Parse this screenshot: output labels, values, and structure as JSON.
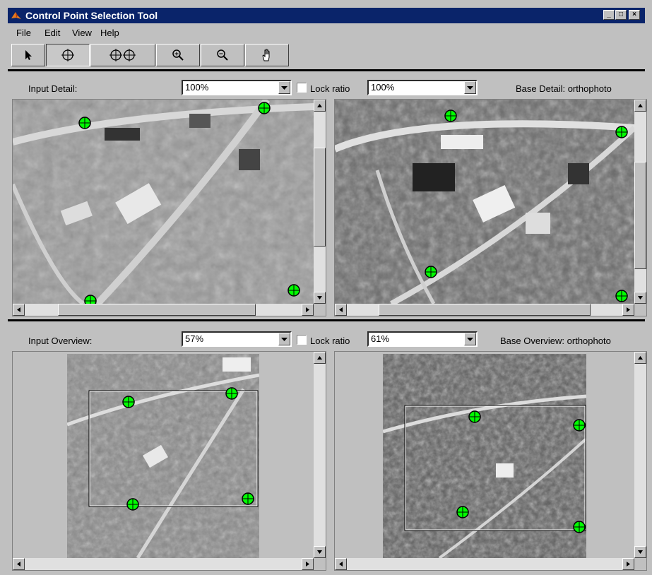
{
  "window": {
    "title": "Control Point Selection Tool",
    "controls": [
      "_",
      "□",
      "×"
    ]
  },
  "menu": {
    "file": "File",
    "edit": "Edit",
    "view": "View",
    "help": "Help"
  },
  "toolbar": {
    "tools": [
      {
        "name": "select-tool",
        "icon": "arrow-cursor-icon",
        "pressed": false
      },
      {
        "name": "add-point-tool",
        "icon": "crosshair-point-icon",
        "pressed": true
      },
      {
        "name": "add-point-pair-tool",
        "icon": "crosshair-pair-icon",
        "pressed": false
      },
      {
        "name": "zoom-in-tool",
        "icon": "zoom-in-icon",
        "pressed": false
      },
      {
        "name": "zoom-out-tool",
        "icon": "zoom-out-icon",
        "pressed": false
      },
      {
        "name": "pan-tool",
        "icon": "hand-icon",
        "pressed": false
      }
    ]
  },
  "detail": {
    "input_label": "Input Detail:",
    "input_zoom": "100%",
    "lock_label": "Lock ratio",
    "lock_checked": false,
    "base_zoom": "100%",
    "base_label": "Base Detail: orthophoto"
  },
  "overview": {
    "input_label": "Input Overview:",
    "input_zoom": "57%",
    "lock_label": "Lock ratio",
    "lock_checked": false,
    "base_zoom": "61%",
    "base_label": "Base Overview: orthophoto"
  },
  "colors": {
    "titlebar": "#0a246a",
    "control_point": "#00ff00",
    "panel_bg": "#c0c0c0"
  }
}
